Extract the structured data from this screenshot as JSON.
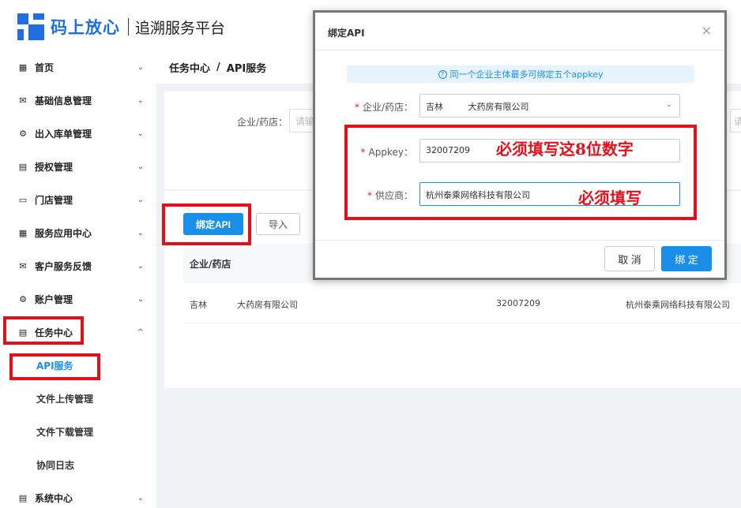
{
  "brand": {
    "name": "码上放心",
    "subtitle": "追溯服务平台",
    "color": "#1f6fe0"
  },
  "sidebar": {
    "items": [
      {
        "label": "首页",
        "icon": "grid-icon",
        "chevron": "⌄"
      },
      {
        "label": "基础信息管理",
        "icon": "mail-icon",
        "chevron": "⌄"
      },
      {
        "label": "出入库单管理",
        "icon": "gear-icon",
        "chevron": "⌄"
      },
      {
        "label": "授权管理",
        "icon": "file-icon",
        "chevron": "⌄"
      },
      {
        "label": "门店管理",
        "icon": "folder-icon",
        "chevron": "⌄"
      },
      {
        "label": "服务应用中心",
        "icon": "grid-icon",
        "chevron": "⌄"
      },
      {
        "label": "客户服务反馈",
        "icon": "mail-icon",
        "chevron": "⌄"
      },
      {
        "label": "账户管理",
        "icon": "gear-icon",
        "chevron": "⌄"
      },
      {
        "label": "任务中心",
        "icon": "file-icon",
        "chevron": "^"
      },
      {
        "label": "系统中心",
        "icon": "file-icon",
        "chevron": "⌄"
      }
    ],
    "sub_items": [
      {
        "label": "API服务",
        "active": true
      },
      {
        "label": "文件上传管理",
        "active": false
      },
      {
        "label": "文件下载管理",
        "active": false
      },
      {
        "label": "协同日志",
        "active": false
      }
    ]
  },
  "breadcrumb": {
    "parent": "任务中心",
    "separator": "/",
    "current": "API服务"
  },
  "filter": {
    "label": "企业/药店：",
    "placeholder": "请输",
    "placeholder_right": "请"
  },
  "toolbar": {
    "bind_label": "绑定API",
    "import_label": "导入"
  },
  "table": {
    "header": "企业/药店",
    "row": {
      "region": "吉林",
      "company": "大药房有限公司",
      "appkey": "32007209",
      "supplier": "杭州泰乘网络科技有限公司"
    }
  },
  "modal": {
    "title": "绑定API",
    "close": "×",
    "notice": "同一个企业主体最多可绑定五个appkey",
    "fields": {
      "company_label": "企业/药店：",
      "company_region": "吉林",
      "company_name": "大药房有限公司",
      "appkey_label": "Appkey：",
      "appkey_value": "32007209",
      "supplier_label": "供应商：",
      "supplier_value": "杭州泰乘网络科技有限公司"
    },
    "cancel_label": "取 消",
    "ok_label": "绑 定"
  },
  "annotations": {
    "appkey_note": "必须填写这8位数字",
    "supplier_note": "必须填写"
  },
  "colors": {
    "primary": "#1a8fe8",
    "annotation": "#e3101c"
  }
}
